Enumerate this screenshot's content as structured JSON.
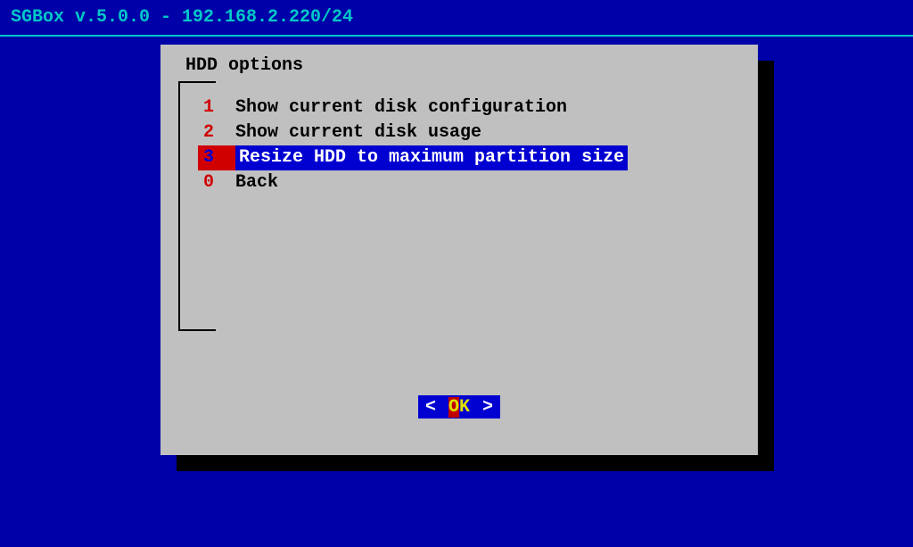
{
  "header": {
    "title": "SGBox v.5.0.0 - 192.168.2.220/24"
  },
  "dialog": {
    "title": "HDD options",
    "menu": [
      {
        "number": "1",
        "label": "Show current disk configuration",
        "selected": false
      },
      {
        "number": "2",
        "label": "Show current disk usage",
        "selected": false
      },
      {
        "number": "3",
        "label": "Resize HDD to maximum partition size",
        "selected": true
      },
      {
        "number": "0",
        "label": "Back",
        "selected": false
      }
    ],
    "button": {
      "left_bracket": "<",
      "ok_first": "O",
      "ok_rest": "K",
      "right_bracket": ">"
    }
  }
}
